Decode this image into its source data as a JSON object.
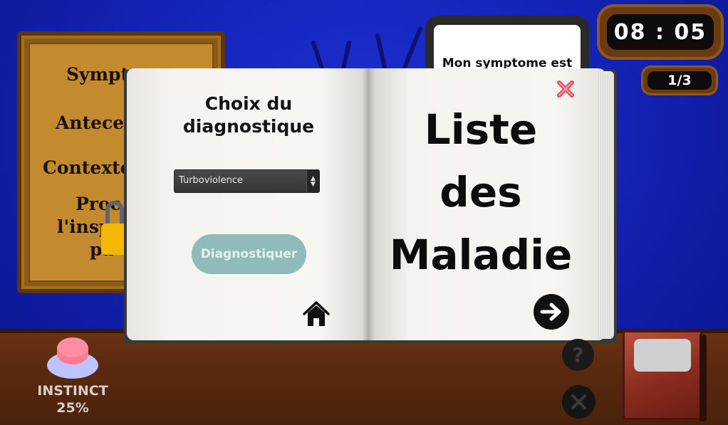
{
  "timer": "08 : 05",
  "counter": "1/3",
  "symptom_card": {
    "text": "Mon symptome est"
  },
  "board": {
    "lines": [
      "Sympt",
      "Antecec",
      "Contexte",
      "Proc",
      "l'insp",
      "pa"
    ]
  },
  "book": {
    "left_title": "Choix du diagnostique",
    "select": {
      "value": "Turboviolence",
      "placeholder": "Turboviolence"
    },
    "diagnose_button": "Diagnostiquer",
    "right_title_lines": [
      "Liste",
      "des",
      "Maladie"
    ]
  },
  "instinct": {
    "label": "INSTINCT",
    "percent": "25%"
  },
  "colors": {
    "sky": "#1424b8",
    "floor": "#5a2a0f",
    "accent_pink": "#ff8ea2",
    "diag_button": "#8fbcb9",
    "close_red": "#e8455a"
  },
  "icons": {
    "home": "home-icon",
    "close": "close-icon",
    "next": "arrow-right-icon",
    "help": "question-icon",
    "quit": "x-icon",
    "lock": "padlock-icon"
  }
}
